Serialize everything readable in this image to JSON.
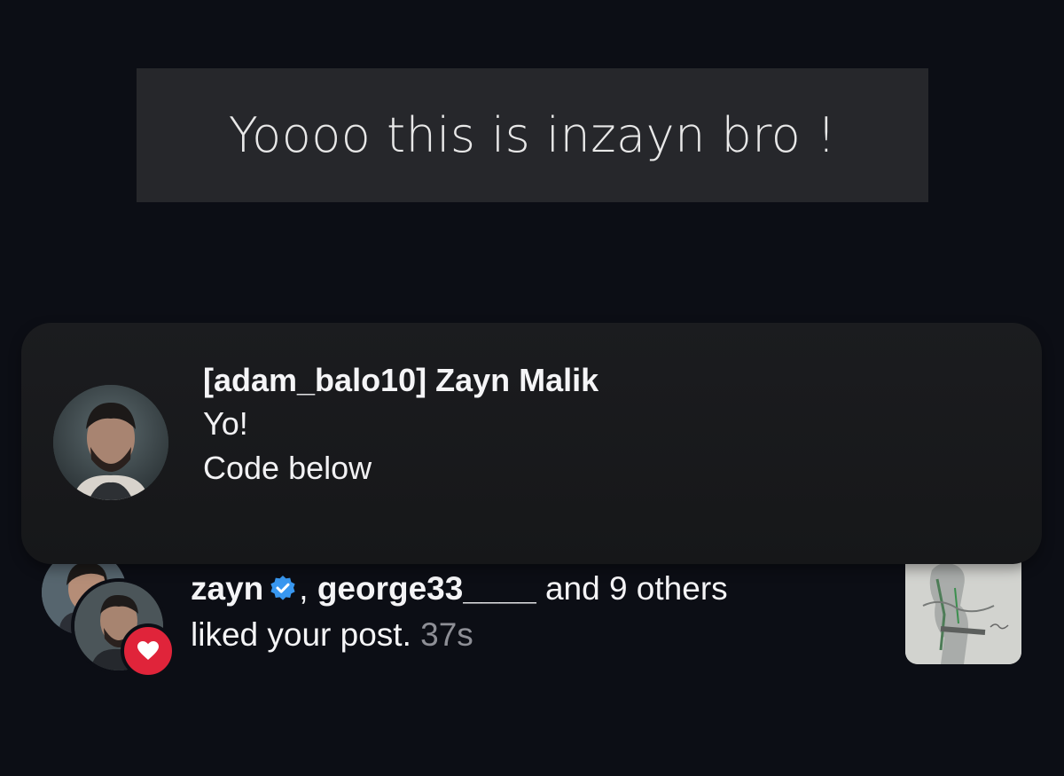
{
  "overlay": {
    "caption": "Yoooo this is inzayn bro !"
  },
  "notification": {
    "sender": "[adam_balo10] Zayn Malik",
    "lines": [
      "Yo!",
      "Code below"
    ]
  },
  "activity": {
    "user1": "zayn",
    "separator": ",",
    "user2": "george33____",
    "others": "and 9 others",
    "action": "liked your post.",
    "time": "37s",
    "badge_icon": "heart-icon",
    "verified_icon": "verified-badge-icon"
  },
  "colors": {
    "background": "#0c0e15",
    "banner": "#1b1c1f",
    "caption_box": "#26272b",
    "heart_red": "#e0243a",
    "verified_blue": "#3897f0",
    "timestamp_gray": "#8e8f96"
  }
}
